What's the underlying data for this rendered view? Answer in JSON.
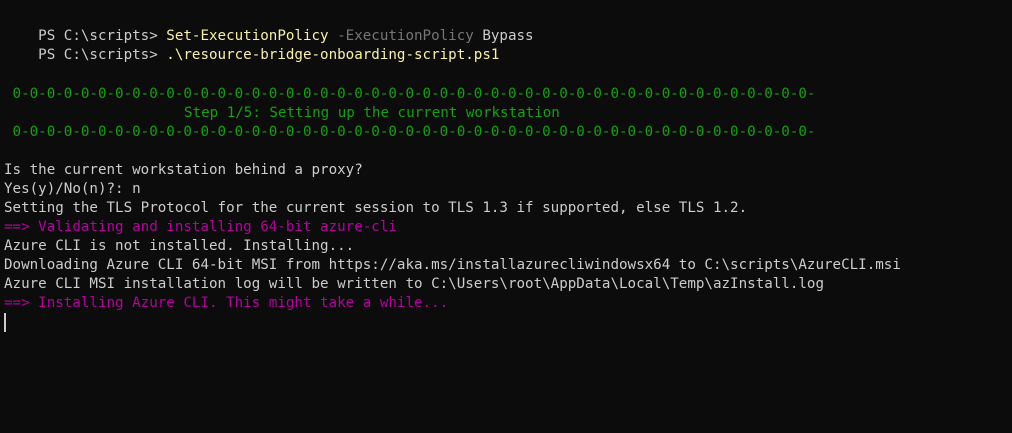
{
  "colors": {
    "background": "#0c0c0c",
    "foreground": "#cccccc",
    "command": "#f9f1a5",
    "parameter": "#767676",
    "banner": "#13a10e",
    "status": "#b4009e"
  },
  "terminal": {
    "prompt_1": "PS C:\\scripts> ",
    "cmd_1": "Set-ExecutionPolicy",
    "param_1": " -ExecutionPolicy",
    "arg_1": " Bypass",
    "prompt_2": "PS C:\\scripts> ",
    "cmd_2": ".\\resource-bridge-onboarding-script.ps1",
    "banner_top": " 0-0-0-0-0-0-0-0-0-0-0-0-0-0-0-0-0-0-0-0-0-0-0-0-0-0-0-0-0-0-0-0-0-0-0-0-0-0-0-0-0-0-0-0-0-0-0-",
    "banner_step": "Step 1/5: Setting up the current workstation",
    "banner_bottom": " 0-0-0-0-0-0-0-0-0-0-0-0-0-0-0-0-0-0-0-0-0-0-0-0-0-0-0-0-0-0-0-0-0-0-0-0-0-0-0-0-0-0-0-0-0-0-0-",
    "question": "Is the current workstation behind a proxy?",
    "answer": "Yes(y)/No(n)?: n",
    "tls": "Setting the TLS Protocol for the current session to TLS 1.3 if supported, else TLS 1.2.",
    "validating": "==> Validating and installing 64-bit azure-cli",
    "not_installed": "Azure CLI is not installed. Installing...",
    "downloading": "Downloading Azure CLI 64-bit MSI from https://aka.ms/installazurecliwindowsx64 to C:\\scripts\\AzureCLI.msi",
    "log_path": "Azure CLI MSI installation log will be written to C:\\Users\\root\\AppData\\Local\\Temp\\azInstall.log",
    "installing": "==> Installing Azure CLI. This might take a while..."
  }
}
